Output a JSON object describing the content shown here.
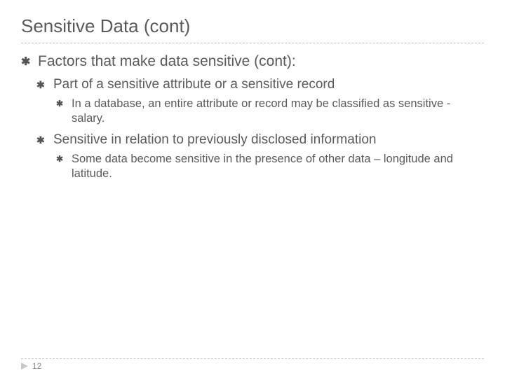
{
  "title": "Sensitive Data (cont)",
  "bulletChar": "✱",
  "l1": {
    "text": "Factors that make data sensitive (cont):"
  },
  "l2a": {
    "text": "Part of a sensitive attribute or a sensitive record"
  },
  "l3a": {
    "text": "In a database, an entire attribute or record may be classified as sensitive - salary."
  },
  "l2b": {
    "text": "Sensitive in relation to previously disclosed information"
  },
  "l3b": {
    "text": "Some data become sensitive in the presence of other data – longitude and latitude."
  },
  "pageNumber": "12"
}
